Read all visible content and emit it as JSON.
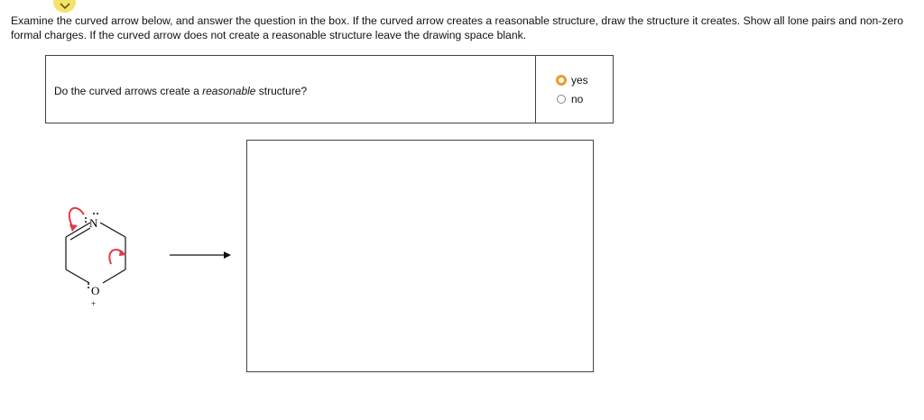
{
  "instructions": "Examine the curved arrow below, and answer the question in the box. If the curved arrow creates a reasonable structure, draw the structure it creates. Show all lone pairs and non-zero formal charges. If the curved arrow does not create a reasonable structure leave the drawing space blank.",
  "question": {
    "prefix": "Do the curved arrows create a ",
    "emphasis": "reasonable",
    "suffix": " structure?"
  },
  "options": [
    {
      "label": "yes",
      "focused": true
    },
    {
      "label": "no",
      "focused": false
    }
  ],
  "molecule": {
    "atom_n": "N",
    "atom_o": "O",
    "charge_o": "+"
  },
  "colors": {
    "curved_arrow": "#e23a4c",
    "focus_ring": "#f19a2a",
    "chevron_bg": "#f4e36a"
  }
}
